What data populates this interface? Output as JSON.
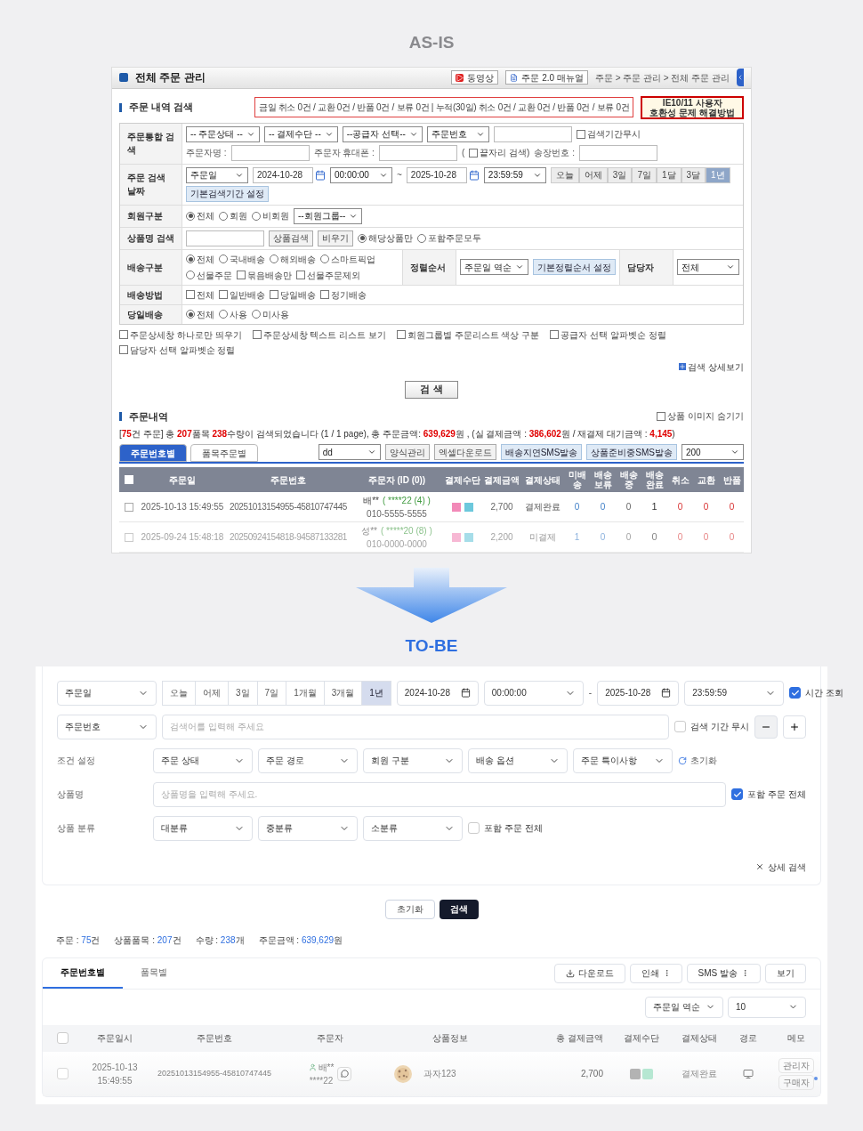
{
  "as_is": {
    "label": "AS-IS",
    "header": {
      "title": "전체 주문 관리",
      "buttons": [
        {
          "kind": "video",
          "label": "동영상"
        },
        {
          "kind": "doc",
          "label": "주문 2.0 매뉴얼"
        }
      ],
      "breadcrumb": "주문 > 주문 관리 > 전체 주문 관리"
    },
    "search_title": "주문 내역 검색",
    "notice": "금일 취소 0건 / 교환 0건 / 반품 0건 / 보류 0건 | 누적(30일) 취소 0건 / 교환 0건 / 반품 0건 / 보류 0건",
    "ie_notice": "IE10/11 사용자\n호환성 문제 해결방법",
    "form_rows": [
      {
        "label": "주문통합 검색",
        "lines": [
          [
            {
              "kind": "select",
              "value": "-- 주문상태 --"
            },
            {
              "kind": "select",
              "value": "-- 결제수단 --"
            },
            {
              "kind": "select",
              "value": "--공급자 선택--"
            },
            {
              "kind": "select",
              "value": "주문번호"
            },
            {
              "kind": "input"
            },
            {
              "kind": "checkbox",
              "label": "검색기간무시",
              "checked": false
            }
          ],
          [
            {
              "kind": "text",
              "text": "주문자명 :"
            },
            {
              "kind": "input"
            },
            {
              "kind": "text",
              "text": "주문자 휴대폰 :"
            },
            {
              "kind": "input"
            },
            {
              "kind": "text",
              "text": "("
            },
            {
              "kind": "checkbox",
              "label": "끝자리 검색)",
              "checked": false
            },
            {
              "kind": "text",
              "text": "송장번호 :"
            },
            {
              "kind": "input"
            }
          ]
        ]
      },
      {
        "label": "주문 검색 날짜",
        "lines": [
          [
            {
              "kind": "select",
              "value": "주문일"
            },
            {
              "kind": "date",
              "value": "2024-10-28"
            },
            {
              "kind": "select",
              "value": "00:00:00"
            },
            {
              "kind": "text",
              "text": "~"
            },
            {
              "kind": "date",
              "value": "2025-10-28"
            },
            {
              "kind": "select",
              "value": "23:59:59"
            },
            {
              "kind": "segment",
              "options": [
                {
                  "label": "오늘",
                  "selected": false
                },
                {
                  "label": "어제",
                  "selected": false
                },
                {
                  "label": "3일",
                  "selected": false
                },
                {
                  "label": "7일",
                  "selected": false
                },
                {
                  "label": "1달",
                  "selected": false
                },
                {
                  "label": "3달",
                  "selected": false
                },
                {
                  "label": "1년",
                  "selected": true
                }
              ]
            },
            {
              "kind": "accent_button",
              "label": "기본검색기간 설정"
            }
          ]
        ]
      },
      {
        "label": "회원구분",
        "lines": [
          [
            {
              "kind": "radio",
              "label": "전체",
              "selected": true
            },
            {
              "kind": "radio",
              "label": "회원",
              "selected": false
            },
            {
              "kind": "radio",
              "label": "비회원",
              "selected": false
            },
            {
              "kind": "select",
              "value": "--회원그룹--"
            }
          ]
        ]
      },
      {
        "label": "상품명 검색",
        "lines": [
          [
            {
              "kind": "input"
            },
            {
              "kind": "button",
              "label": "상품검색"
            },
            {
              "kind": "button",
              "label": "비우기"
            },
            {
              "kind": "radio",
              "label": "해당상품만",
              "selected": true
            },
            {
              "kind": "radio",
              "label": "포함주문모두",
              "selected": false
            }
          ]
        ]
      },
      {
        "label": "배송구분",
        "lines": [
          [
            {
              "kind": "radio",
              "label": "전체",
              "selected": true
            },
            {
              "kind": "radio",
              "label": "국내배송",
              "selected": false
            },
            {
              "kind": "radio",
              "label": "해외배송",
              "selected": false
            },
            {
              "kind": "radio",
              "label": "스마트픽업",
              "selected": false
            }
          ],
          [
            {
              "kind": "radio",
              "label": "선물주문",
              "selected": false
            },
            {
              "kind": "checkbox",
              "label": "묶음배송만",
              "checked": false
            },
            {
              "kind": "checkbox",
              "label": "선물주문제외",
              "checked": false
            }
          ]
        ],
        "side": [
          {
            "label": "정렬순서",
            "items": [
              {
                "kind": "select",
                "value": "주문일 역순"
              },
              {
                "kind": "accent_button",
                "label": "기본정렬순서 설정"
              }
            ]
          },
          {
            "label": "담당자",
            "items": [
              {
                "kind": "select",
                "value": "전체"
              }
            ]
          }
        ]
      },
      {
        "label": "배송방법",
        "lines": [
          [
            {
              "kind": "checkbox",
              "label": "전체",
              "checked": false
            },
            {
              "kind": "checkbox",
              "label": "일반배송",
              "checked": false
            },
            {
              "kind": "checkbox",
              "label": "당일배송",
              "checked": false
            },
            {
              "kind": "checkbox",
              "label": "정기배송",
              "checked": false
            }
          ]
        ]
      },
      {
        "label": "당일배송",
        "lines": [
          [
            {
              "kind": "radio",
              "label": "전체",
              "selected": true
            },
            {
              "kind": "radio",
              "label": "사용",
              "selected": false
            },
            {
              "kind": "radio",
              "label": "미사용",
              "selected": false
            }
          ]
        ]
      }
    ],
    "options": [
      {
        "label": "주문상세창 하나로만 띄우기",
        "checked": false
      },
      {
        "label": "주문상세창 텍스트 리스트 보기",
        "checked": false
      },
      {
        "label": "회원그룹별 주문리스트 색상 구분",
        "checked": false
      },
      {
        "label": "공급자 선택 알파벳순 정렬",
        "checked": false
      },
      {
        "label": "담당자 선택 알파벳순 정렬",
        "checked": false
      }
    ],
    "detail_link": "검색 상세보기",
    "search_button": "검 색",
    "results": {
      "title": "주문내역",
      "hide_images": {
        "label": "상품 이미지 숨기기",
        "checked": false
      },
      "summary": "[**75**건 주문] 총 **207**품목 **238**수량이 검색되었습니다 (1 / 1 page), 총 주문금액: **639,629**원 , (실 결제금액 : **386,602**원 / 재결제 대기금액 : **4,145**)",
      "tabs": [
        {
          "label": "주문번호별",
          "selected": true
        },
        {
          "label": "품목주문별",
          "selected": false
        }
      ],
      "toolbar": [
        {
          "kind": "select",
          "value": "dd"
        },
        {
          "kind": "button",
          "label": "양식관리"
        },
        {
          "kind": "button",
          "label": "엑셀다운로드"
        },
        {
          "kind": "accent_button",
          "label": "배송지연SMS발송"
        },
        {
          "kind": "accent_button",
          "label": "상품준비중SMS발송"
        },
        {
          "kind": "select",
          "value": "200"
        }
      ],
      "select_all": {
        "checked": false
      },
      "columns": [
        "주문일",
        "주문번호",
        "주문자 (ID (0))",
        "결제수단",
        "결제금액",
        "결제상태",
        "미배송",
        "배송 보류",
        "배송중",
        "배송 완료",
        "취소",
        "교환",
        "반품"
      ],
      "rows": [
        {
          "checked": false,
          "faded": false,
          "date": "2025-10-13 15:49:55",
          "number": "20251013154955-45810747445",
          "buyer": "배**",
          "buyer_id": "( ****22 (4) )",
          "phone": "010-5555-5555",
          "amount": "2,700",
          "status": "결제완료",
          "counts": [
            "0",
            "0",
            "0",
            "1",
            "0",
            "0",
            "0"
          ]
        },
        {
          "checked": false,
          "faded": true,
          "date": "2025-09-24 15:48:18",
          "number": "20250924154818-94587133281",
          "buyer": "성**",
          "buyer_id": "( *****20 (8) )",
          "phone": "010-0000-0000",
          "amount": "2,200",
          "status": "미결제",
          "counts": [
            "1",
            "0",
            "0",
            "0",
            "0",
            "0",
            "0"
          ]
        }
      ]
    }
  },
  "to_be": {
    "label": "TO-BE",
    "filter_rows": [
      {
        "items": [
          {
            "kind": "select",
            "value": "주문일"
          },
          {
            "kind": "segment",
            "options": [
              {
                "label": "오늘",
                "selected": false
              },
              {
                "label": "어제",
                "selected": false
              },
              {
                "label": "3일",
                "selected": false
              },
              {
                "label": "7일",
                "selected": false
              },
              {
                "label": "1개월",
                "selected": false
              },
              {
                "label": "3개월",
                "selected": false
              },
              {
                "label": "1년",
                "selected": true
              }
            ]
          },
          {
            "kind": "date",
            "value": "2024-10-28"
          },
          {
            "kind": "select",
            "value": "00:00:00"
          },
          {
            "kind": "text",
            "text": "-"
          },
          {
            "kind": "date",
            "value": "2025-10-28"
          },
          {
            "kind": "select",
            "value": "23:59:59"
          },
          {
            "kind": "checkbox",
            "label": "시간 조회",
            "checked": true
          }
        ]
      },
      {
        "items": [
          {
            "kind": "select",
            "value": "주문번호"
          },
          {
            "kind": "input",
            "placeholder": "검색어를 입력해 주세요"
          },
          {
            "kind": "checkbox",
            "label": "검색 기간 무시",
            "checked": false
          },
          {
            "kind": "minus"
          },
          {
            "kind": "plus"
          }
        ]
      },
      {
        "label": "조건 설정",
        "items": [
          {
            "kind": "select",
            "value": "주문 상태"
          },
          {
            "kind": "select",
            "value": "주문 경로"
          },
          {
            "kind": "select",
            "value": "회원 구분"
          },
          {
            "kind": "select",
            "value": "배송 옵션"
          },
          {
            "kind": "select",
            "value": "주문 특이사항"
          },
          {
            "kind": "reset",
            "label": "초기화"
          }
        ]
      },
      {
        "label": "상품명",
        "items": [
          {
            "kind": "input",
            "placeholder": "상품명을 입력해 주세요."
          },
          {
            "kind": "checkbox",
            "label": "포함 주문 전체",
            "checked": true
          }
        ]
      },
      {
        "label": "상품 분류",
        "items": [
          {
            "kind": "select",
            "value": "대분류"
          },
          {
            "kind": "select",
            "value": "중분류"
          },
          {
            "kind": "select",
            "value": "소분류"
          },
          {
            "kind": "checkbox",
            "label": "포함 주문 전체",
            "checked": false
          }
        ]
      }
    ],
    "detail_toggle": "상세 검색",
    "buttons": [
      {
        "kind": "secondary",
        "label": "초기화"
      },
      {
        "kind": "primary",
        "label": "검색"
      }
    ],
    "stats": [
      {
        "label": "주문 : ",
        "value": "75",
        "unit": "건"
      },
      {
        "label": "상품품목 : ",
        "value": "207",
        "unit": "건"
      },
      {
        "label": "수량 : ",
        "value": "238",
        "unit": "개"
      },
      {
        "label": "주문금액 : ",
        "value": "639,629",
        "unit": "원"
      }
    ],
    "tabs": [
      {
        "label": "주문번호별",
        "selected": true
      },
      {
        "label": "품목별",
        "selected": false
      }
    ],
    "actions": [
      {
        "kind": "download",
        "label": "다운로드"
      },
      {
        "kind": "menu",
        "label": "인쇄"
      },
      {
        "kind": "menu",
        "label": "SMS 발송"
      },
      {
        "kind": "plain",
        "label": "보기"
      }
    ],
    "sorts": [
      "주문일 역순",
      "10"
    ],
    "select_all": {
      "checked": false
    },
    "columns": [
      "주문일시",
      "주문번호",
      "주문자",
      "상품정보",
      "총 결제금액",
      "결제수단",
      "결제상태",
      "경로",
      "메모"
    ],
    "rows": [
      {
        "checked": false,
        "date": "2025-10-13",
        "time": "15:49:55",
        "number": "20251013154955-45810747445",
        "buyer": "배**",
        "buyer_id": "****22",
        "product": "과자123",
        "amount": "2,700",
        "status": "결제완료",
        "memos": [
          {
            "label": "관리자",
            "flag": false
          },
          {
            "label": "구매자",
            "flag": true
          }
        ]
      }
    ]
  }
}
